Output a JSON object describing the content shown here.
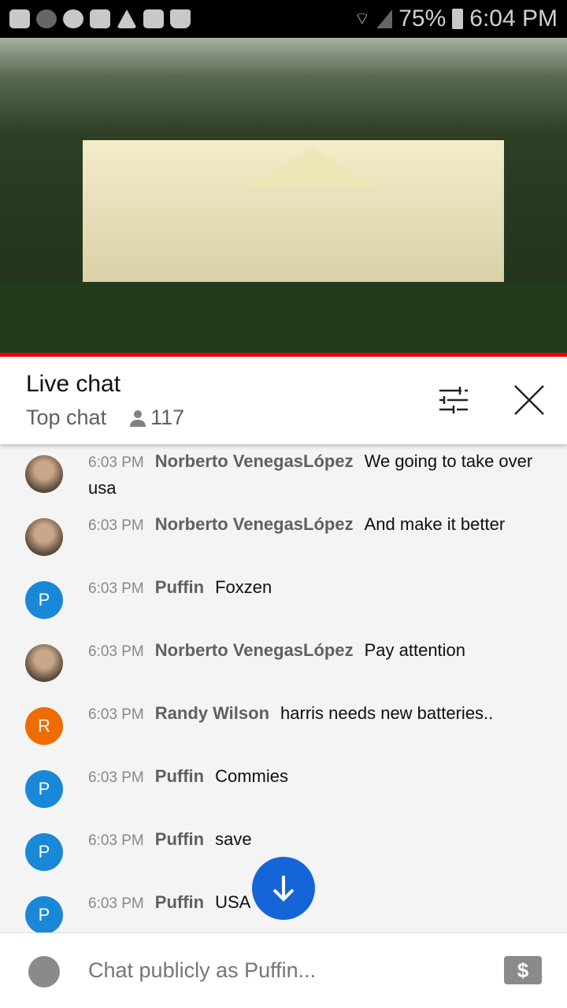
{
  "status_bar": {
    "battery": "75%",
    "time": "6:04 PM",
    "notification_icons": [
      "youtube-icon",
      "m-icon",
      "m-icon",
      "folder-icon",
      "warning-icon",
      "image-icon",
      "shopping-bag-icon"
    ]
  },
  "header": {
    "title": "Live chat",
    "mode": "Top chat",
    "viewer_count": "117"
  },
  "messages": [
    {
      "time": "6:03 PM",
      "author": "Norberto VenegasLópez",
      "text": "We going to take over usa",
      "avatar": "photo"
    },
    {
      "time": "6:03 PM",
      "author": "Norberto VenegasLópez",
      "text": "And make it better",
      "avatar": "photo"
    },
    {
      "time": "6:03 PM",
      "author": "Puffin",
      "text": "Foxzen",
      "avatar": "P",
      "color": "#1a88d8"
    },
    {
      "time": "6:03 PM",
      "author": "Norberto VenegasLópez",
      "text": "Pay attention",
      "avatar": "photo"
    },
    {
      "time": "6:03 PM",
      "author": "Randy Wilson",
      "text": "harris needs new batteries..",
      "avatar": "R",
      "color": "#ef6c00"
    },
    {
      "time": "6:03 PM",
      "author": "Puffin",
      "text": "Commies",
      "avatar": "P",
      "color": "#1a88d8"
    },
    {
      "time": "6:03 PM",
      "author": "Puffin",
      "text": "save",
      "avatar": "P",
      "color": "#1a88d8"
    },
    {
      "time": "6:03 PM",
      "author": "Puffin",
      "text": "USA",
      "avatar": "P",
      "color": "#1a88d8"
    }
  ],
  "input": {
    "placeholder": "Chat publicly as Puffin..."
  },
  "colors": {
    "accent": "#1565d8",
    "progress": "#e00000"
  }
}
